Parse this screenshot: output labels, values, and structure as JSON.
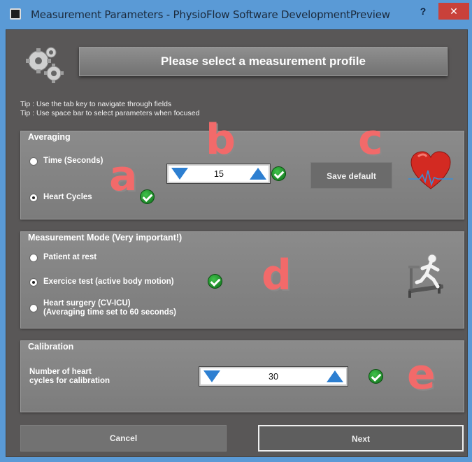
{
  "window": {
    "title": "Measurement Parameters - PhysioFlow Software DevelopmentPreview",
    "help_label": "?",
    "close_label": "✕"
  },
  "header": {
    "title": "Please select a measurement profile"
  },
  "tips": [
    "Tip : Use the tab key to navigate through fields",
    "Tip : Use space bar to select parameters when focused"
  ],
  "averaging": {
    "title": "Averaging",
    "options": [
      {
        "label": "Time (Seconds)",
        "selected": false
      },
      {
        "label": "Heart Cycles",
        "selected": true
      }
    ],
    "value": "15",
    "save_label": "Save default"
  },
  "measurement_mode": {
    "title": "Measurement Mode (Very important!)",
    "options": [
      {
        "label": "Patient at rest",
        "selected": false
      },
      {
        "label": "Exercice test (active body motion)",
        "selected": true
      },
      {
        "label": "Heart surgery (CV-ICU)\n(Averaging time set to 60 seconds)",
        "selected": false
      }
    ]
  },
  "calibration": {
    "title": "Calibration",
    "label": "Number of heart\ncycles for calibration",
    "value": "30"
  },
  "annotations": {
    "a": "a",
    "b": "b",
    "c": "c",
    "d": "d",
    "e": "e"
  },
  "footer": {
    "cancel_label": "Cancel",
    "next_label": "Next"
  },
  "colors": {
    "accent_blue": "#2d7fd1",
    "annotation_red": "#f26a6a",
    "check_green": "#1e9a2c",
    "close_red": "#c9413a"
  }
}
